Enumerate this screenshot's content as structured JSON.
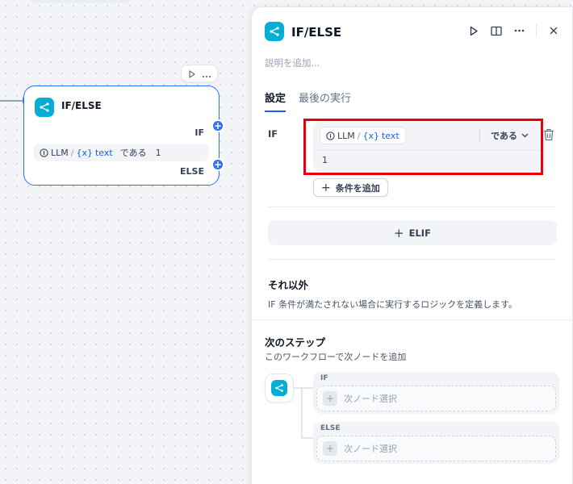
{
  "node": {
    "title": "IF/ELSE",
    "if_label": "IF",
    "else_label": "ELSE",
    "condition": {
      "source": "LLM",
      "separator": "/",
      "var_prefix": "{x}",
      "variable": "text",
      "operator": "である",
      "value": "1"
    }
  },
  "panel": {
    "title": "IF/ELSE",
    "description_placeholder": "説明を追加...",
    "tabs": [
      {
        "label": "設定"
      },
      {
        "label": "最後の実行"
      }
    ],
    "if_label": "IF",
    "condition": {
      "source": "LLM",
      "separator": "/",
      "var_prefix": "{x}",
      "variable": "text",
      "operator": "である",
      "value": "1"
    },
    "add_condition_label": "条件を追加",
    "elif_label": "ELIF",
    "else_section": {
      "title": "それ以外",
      "description": "IF 条件が満たされない場合に実行するロジックを定義します。"
    },
    "next_step": {
      "title": "次のステップ",
      "description": "このワークフローで次ノードを追加",
      "branches": [
        {
          "label": "IF",
          "select_label": "次ノード選択"
        },
        {
          "label": "ELSE",
          "select_label": "次ノード選択"
        }
      ]
    }
  },
  "colors": {
    "accent": "#155eef",
    "node_icon": "#06aed4",
    "highlight": "#e5000d"
  }
}
